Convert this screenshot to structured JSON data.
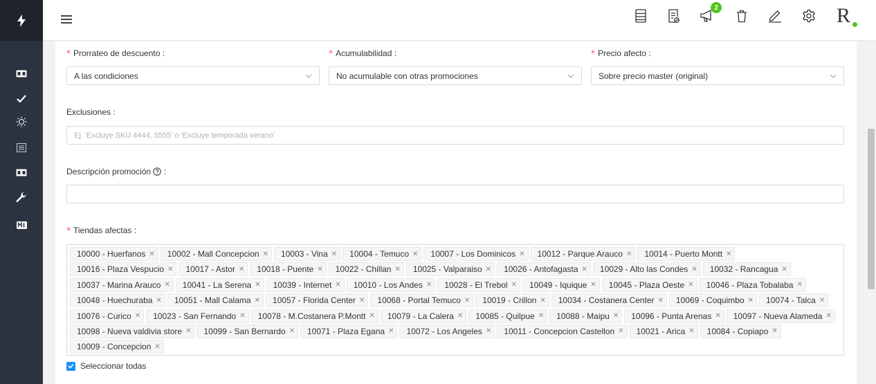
{
  "topbar": {
    "notification_count": "2",
    "logo_letter": "R"
  },
  "sidebar": {
    "icons": [
      "lightning-icon",
      "ticket-icon",
      "check-icon",
      "sun-icon",
      "list-icon",
      "ticket-icon",
      "wrench-icon",
      "mi-icon"
    ]
  },
  "form": {
    "prorrateo": {
      "label": "Prorrateo de descuento",
      "value": "A las condiciones"
    },
    "acumulabilidad": {
      "label": "Acumulabilidad",
      "value": "No acumulable con otras promociones"
    },
    "precio": {
      "label": "Precio afecto",
      "value": "Sobre precio master (original)"
    },
    "exclusiones": {
      "label": "Exclusiones",
      "placeholder": "Ej. 'Excluye SKU 4444, 5555' o 'Excluye temporada verano'"
    },
    "descripcion": {
      "label": "Descripción promoción"
    },
    "tiendas": {
      "label": "Tiendas afectas",
      "tags": [
        "10000 - Huerfanos",
        "10002 - Mall Concepcion",
        "10003 - Vina",
        "10004 - Temuco",
        "10007 - Los Dominicos",
        "10012 - Parque Arauco",
        "10014 - Puerto Montt",
        "10016 - Plaza Vespucio",
        "10017 - Astor",
        "10018 - Puente",
        "10022 - Chillan",
        "10025 - Valparaiso",
        "10026 - Antofagasta",
        "10029 - Alto las Condes",
        "10032 - Rancagua",
        "10037 - Marina Arauco",
        "10041 - La Serena",
        "10039 - Internet",
        "10010 - Los Andes",
        "10028 - El Trebol",
        "10049 - Iquique",
        "10045 - Plaza Oeste",
        "10046 - Plaza Tobalaba",
        "10048 - Huechuraba",
        "10051 - Mall Calama",
        "10057 - Florida Center",
        "10068 - Portal Temuco",
        "10019 - Crillon",
        "10034 - Costanera Center",
        "10069 - Coquimbo",
        "10074 - Talca",
        "10076 - Curico",
        "10023 - San Fernando",
        "10078 - M.Costanera P.Montt",
        "10079 - La Calera",
        "10085 - Quilpue",
        "10088 - Maipu",
        "10096 - Punta Arenas",
        "10097 - Nueva Alameda",
        "10098 - Nueva valdivia store",
        "10099 - San Bernardo",
        "10071 - Plaza Egana",
        "10072 - Los Angeles",
        "10011 - Concepcion Castellon",
        "10021 - Arica",
        "10084 - Copiapo",
        "10009 - Concepcion"
      ]
    },
    "select_all": {
      "label": "Seleccionar todas",
      "checked": true
    }
  },
  "colors": {
    "accent": "#1890ff",
    "required": "#ff4d4f",
    "badge": "#52c41a",
    "sidebar": "#2c3340"
  }
}
